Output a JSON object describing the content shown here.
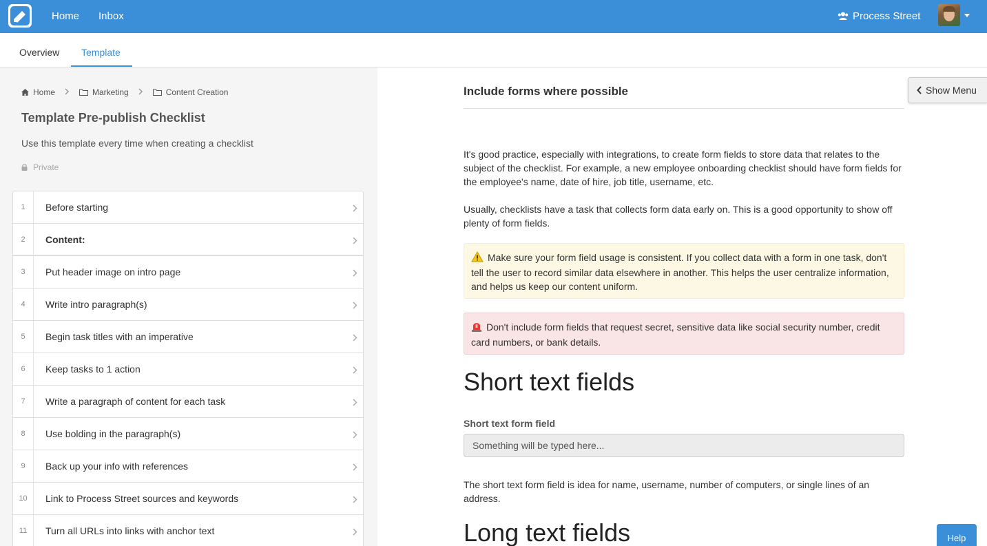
{
  "navbar": {
    "home_label": "Home",
    "inbox_label": "Inbox",
    "org_name": "Process Street",
    "brand_color": "#3b8fd9"
  },
  "tabs": [
    {
      "label": "Overview",
      "active": false
    },
    {
      "label": "Template",
      "active": true
    }
  ],
  "breadcrumb": [
    {
      "label": "Home",
      "icon": "home-icon"
    },
    {
      "label": "Marketing",
      "icon": "folder-icon"
    },
    {
      "label": "Content Creation",
      "icon": "folder-icon"
    }
  ],
  "template": {
    "title": "Template Pre-publish Checklist",
    "description": "Use this template every time when creating a checklist",
    "privacy": "Private"
  },
  "tasks": [
    {
      "num": "1",
      "name": "Before starting",
      "heading": false
    },
    {
      "num": "2",
      "name": "Content:",
      "heading": true
    },
    {
      "num": "3",
      "name": "Put header image on intro page",
      "heading": false
    },
    {
      "num": "4",
      "name": "Write intro paragraph(s)",
      "heading": false
    },
    {
      "num": "5",
      "name": "Begin task titles with an imperative",
      "heading": false
    },
    {
      "num": "6",
      "name": "Keep tasks to 1 action",
      "heading": false
    },
    {
      "num": "7",
      "name": "Write a paragraph of content for each task",
      "heading": false
    },
    {
      "num": "8",
      "name": "Use bolding in the paragraph(s)",
      "heading": false
    },
    {
      "num": "9",
      "name": "Back up your info with references",
      "heading": false
    },
    {
      "num": "10",
      "name": "Link to Process Street sources and keywords",
      "heading": false
    },
    {
      "num": "11",
      "name": "Turn all URLs into links with anchor text",
      "heading": false
    }
  ],
  "content": {
    "task_title": "Include forms where possible",
    "para1": "It's good practice, especially with integrations, to create form fields to store data that relates to the subject of the checklist. For example, a new employee onboarding checklist should have form fields for the employee's name, date of hire, job title, username, etc.",
    "para2": "Usually, checklists have a task that collects form data early on. This is a good opportunity to show off plenty of form fields.",
    "warning_text": "Make sure your form field usage is consistent. If you collect data with a form in one task, don't tell the user to record similar data elsewhere in another. This helps the user centralize information, and helps us keep our content uniform.",
    "danger_text": "Don't include form fields that request secret, sensitive data like social security number, credit card numbers, or bank details.",
    "heading_short": "Short text fields",
    "short_field_label": "Short text form field",
    "short_field_placeholder": "Something will be typed here...",
    "para3": "The short text form field is idea for name, username, number of computers, or single lines of an address.",
    "heading_long": "Long text fields"
  },
  "show_menu_label": "Show Menu",
  "help_label": "Help"
}
